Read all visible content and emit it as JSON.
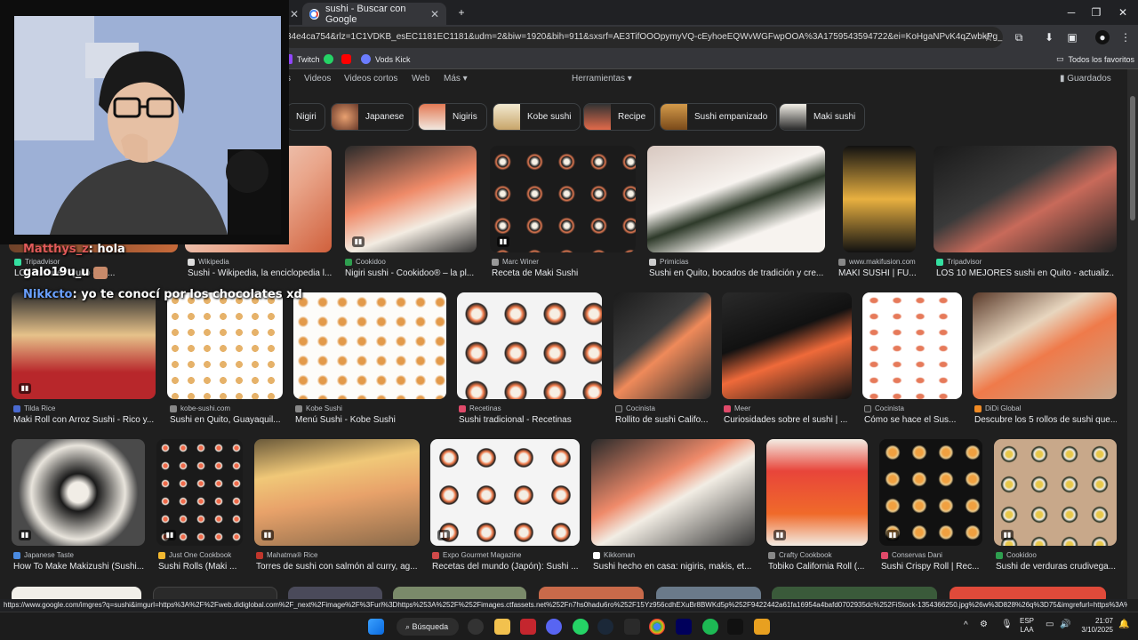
{
  "tabs": [
    {
      "title": "sushi - Buscar con Google",
      "close": "✕"
    }
  ],
  "window": {
    "minimize": "─",
    "maximize": "❐",
    "close": "✕",
    "new_tab": "+"
  },
  "omnibox": {
    "url": "34e4ca754&rlz=1C1VDKB_esEC1181EC1181&udm=2&biw=1920&bih=911&sxsrf=AE3TifOOOpymyVQ-cEyhoeEQWvWGFwpOOA%3A1759543594722&ei=KoHgaNPvK4qZwbkPg_XNiAU&..."
  },
  "bookmarks": [
    {
      "label": "Twitch",
      "color": "#9146ff"
    },
    {
      "label": "",
      "color": "#25d366"
    },
    {
      "label": "",
      "color": "#ff0000"
    },
    {
      "label": "Vods Kick",
      "color": "#53fc18"
    }
  ],
  "bookmarks_right": "Todos los favoritos",
  "google_nav": {
    "videos": "Videos",
    "short_videos": "Videos cortos",
    "web": "Web",
    "more": "Más",
    "tools": "Herramientas",
    "saved": "Guardados"
  },
  "chips": [
    {
      "label": "Nigiri"
    },
    {
      "label": "Japanese"
    },
    {
      "label": "Nigiris"
    },
    {
      "label": "Kobe sushi"
    },
    {
      "label": "Recipe"
    },
    {
      "label": "Sushi empanizado"
    },
    {
      "label": "Maki sushi"
    }
  ],
  "row1": [
    {
      "source": "Tripadvisor",
      "title": "LO...sushi en Quito - ac..."
    },
    {
      "source": "Wikipedia",
      "title": "Sushi - Wikipedia, la enciclopedia l..."
    },
    {
      "source": "Cookidoo",
      "title": "Nigiri sushi - Cookidoo® – la pl..."
    },
    {
      "source": "Marc Winer",
      "title": "Receta de Maki Sushi"
    },
    {
      "source": "Primicias",
      "title": "Sushi en Quito, bocados de tradición y cre..."
    },
    {
      "source": "www.makifusion.com",
      "title": "MAKI SUSHI | FU..."
    },
    {
      "source": "Tripadvisor",
      "title": "LOS 10 MEJORES sushi en Quito - actualiz..."
    }
  ],
  "row2": [
    {
      "source": "Tilda Rice",
      "title": "Maki Roll con Arroz Sushi - Rico y..."
    },
    {
      "source": "kobe-sushi.com",
      "title": "Sushi en Quito, Guayaquil..."
    },
    {
      "source": "Kobe Sushi",
      "title": "Menú Sushi - Kobe Sushi"
    },
    {
      "source": "Recetinas",
      "title": "Sushi tradicional - Recetinas"
    },
    {
      "source": "Cocinista",
      "title": "Rollito de sushi Califo..."
    },
    {
      "source": "Meer",
      "title": "Curiosidades sobre el sushi | ..."
    },
    {
      "source": "Cocinista",
      "title": "Cómo se hace el Sus..."
    },
    {
      "source": "DiDi Global",
      "title": "Descubre los 5 rollos de sushi que..."
    }
  ],
  "row3": [
    {
      "source": "Japanese Taste",
      "title": "How To Make Makizushi (Sushi..."
    },
    {
      "source": "Just One Cookbook",
      "title": "Sushi Rolls (Maki ..."
    },
    {
      "source": "Mahatma® Rice",
      "title": "Torres de sushi con salmón al curry, ag..."
    },
    {
      "source": "Expo Gourmet Magazine",
      "title": "Recetas del mundo (Japón): Sushi ..."
    },
    {
      "source": "Kikkoman",
      "title": "Sushi hecho en casa: nigiris, makis, et..."
    },
    {
      "source": "Crafty Cookbook",
      "title": "Tobiko California Roll (..."
    },
    {
      "source": "Conservas Dani",
      "title": "Sushi Crispy Roll | Rec..."
    },
    {
      "source": "Cookidoo",
      "title": "Sushi de verduras crudivega..."
    }
  ],
  "status_url": "https://www.google.com/imgres?q=sushi&imgurl=https%3A%2F%2Fweb.didiglobal.com%2F_next%2Fimage%2F%3Furl%3Dhttps%253A%252F%252Fimages.ctfassets.net%252Fn7hs0hadu6ro%252F15Yz956cdhEXuBr8BWKd5p%252F9422442a61fa16954a4bafd0702935dc%252FiStock-1354366250.jpg%26w%3D828%26q%3D75&imgrefurl=https%3A%2F...",
  "chat": [
    {
      "user": "Matthys_z",
      "message": ": hola",
      "color": "#e05a5a"
    },
    {
      "user": "galo19u_u",
      "message": "",
      "color": "#ffffff"
    },
    {
      "user": "Nikkcto",
      "message": ": yo te conocí por los chocolates xd",
      "color": "#6aa0ff"
    }
  ],
  "taskbar": {
    "search": "Búsqueda",
    "lang": "ESP",
    "lang2": "LAA",
    "time": "21:07",
    "date": "3/10/2025",
    "badge1": "",
    "badge2": "99+",
    "badge3": "30"
  }
}
